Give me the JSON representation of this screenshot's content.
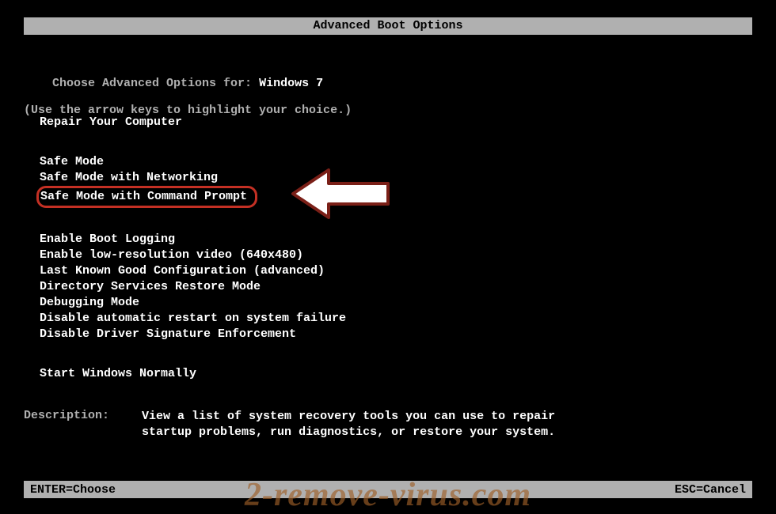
{
  "title": "Advanced Boot Options",
  "intro": {
    "prefix": "Choose Advanced Options for: ",
    "os": "Windows 7",
    "hint": "(Use the arrow keys to highlight your choice.)"
  },
  "groups": [
    {
      "items": [
        "Repair Your Computer"
      ]
    },
    {
      "items": [
        "Safe Mode",
        "Safe Mode with Networking",
        "Safe Mode with Command Prompt"
      ],
      "highlight_index": 2
    },
    {
      "items": [
        "Enable Boot Logging",
        "Enable low-resolution video (640x480)",
        "Last Known Good Configuration (advanced)",
        "Directory Services Restore Mode",
        "Debugging Mode",
        "Disable automatic restart on system failure",
        "Disable Driver Signature Enforcement"
      ]
    },
    {
      "items": [
        "Start Windows Normally"
      ]
    }
  ],
  "description": {
    "label": "Description:   ",
    "text": "View a list of system recovery tools you can use to repair startup problems, run diagnostics, or restore your system."
  },
  "footer": {
    "left": "ENTER=Choose",
    "right": "ESC=Cancel"
  },
  "watermark": "2-remove-virus.com"
}
